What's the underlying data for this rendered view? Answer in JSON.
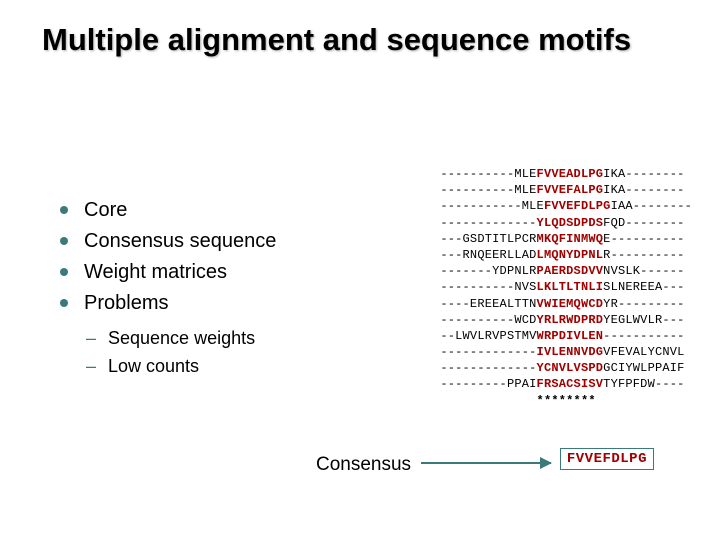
{
  "title": "Multiple alignment and sequence motifs",
  "bullets": {
    "b0": "Core",
    "b1": "Consensus sequence",
    "b2": "Weight matrices",
    "b3": "Problems",
    "s0": "Sequence weights",
    "s1": "Low counts"
  },
  "alignment": {
    "rows": [
      {
        "pre": "----------MLE",
        "hl": "FVVEADLPG",
        "post": "IKA--------"
      },
      {
        "pre": "----------MLE",
        "hl": "FVVEFALPG",
        "post": "IKA--------"
      },
      {
        "pre": "-----------MLE",
        "hl": "FVVEFDLPG",
        "post": "IAA--------"
      },
      {
        "pre": "-------------",
        "hl": "YLQDSDPDS",
        "post": "FQD--------"
      },
      {
        "pre": "---GSDTITLPCR",
        "hl": "MKQFINMWQ",
        "post": "E----------"
      },
      {
        "pre": "---RNQEERLLAD",
        "hl": "LMQNYDPNL",
        "post": "R----------"
      },
      {
        "pre": "-------YDPNLR",
        "hl": "PAERDSDVV",
        "post": "NVSLK------"
      },
      {
        "pre": "----------NVS",
        "hl": "LKLTLTNLI",
        "post": "SLNEREEA---"
      },
      {
        "pre": "----EREEALTTN",
        "hl": "VWIEMQWCD",
        "post": "YR---------"
      },
      {
        "pre": "----------WCD",
        "hl": "YRLRWDPRD",
        "post": "YEGLWVLR---"
      },
      {
        "pre": "--LWVLRVPSTMV",
        "hl": "WRPDIVLEN",
        "post": "-----------"
      },
      {
        "pre": "-------------",
        "hl": "IVLENNVDG",
        "post": "VFEVALYCNVL"
      },
      {
        "pre": "-------------",
        "hl": "YCNVLVSPD",
        "post": "GCIYWLPPAIF"
      },
      {
        "pre": "---------PPAI",
        "hl": "FRSACSISV",
        "post": "TYFPFDW----"
      }
    ],
    "stars": "********"
  },
  "consensus_label": "Consensus",
  "consensus_value": "FVVEFDLPG"
}
